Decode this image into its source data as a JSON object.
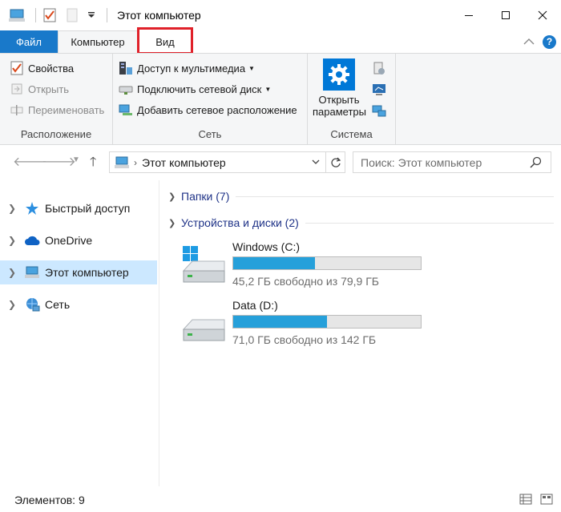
{
  "window": {
    "title": "Этот компьютер",
    "minimize_icon": "minimize-icon",
    "maximize_icon": "maximize-icon",
    "close_icon": "close-icon"
  },
  "tabs": {
    "file": "Файл",
    "computer": "Компьютер",
    "view": "Вид"
  },
  "ribbon": {
    "location": {
      "label": "Расположение",
      "properties": "Свойства",
      "open": "Открыть",
      "rename": "Переименовать"
    },
    "network": {
      "label": "Сеть",
      "media_access": "Доступ к мультимедиа",
      "map_drive": "Подключить сетевой диск",
      "add_location": "Добавить сетевое расположение"
    },
    "system": {
      "label": "Система",
      "settings_line1": "Открыть",
      "settings_line2": "параметры"
    }
  },
  "address": {
    "path": "Этот компьютер",
    "search_placeholder": "Поиск: Этот компьютер"
  },
  "nav": {
    "items": [
      {
        "label": "Быстрый доступ",
        "icon": "star-icon"
      },
      {
        "label": "OneDrive",
        "icon": "cloud-icon"
      },
      {
        "label": "Этот компьютер",
        "icon": "computer-icon",
        "selected": true
      },
      {
        "label": "Сеть",
        "icon": "network-icon"
      }
    ]
  },
  "content": {
    "folders_section": "Папки (7)",
    "devices_section": "Устройства и диски (2)",
    "drives": [
      {
        "name": "Windows (C:)",
        "free_text": "45,2 ГБ свободно из 79,9 ГБ",
        "used_fraction": 0.434
      },
      {
        "name": "Data (D:)",
        "free_text": "71,0 ГБ свободно из 142 ГБ",
        "used_fraction": 0.5
      }
    ]
  },
  "status": {
    "items_count": "Элементов: 9"
  },
  "colors": {
    "accent": "#1979ca",
    "bar_fill": "#26a0da",
    "highlight_box": "#e0212a",
    "selected_nav": "#cce8ff"
  }
}
